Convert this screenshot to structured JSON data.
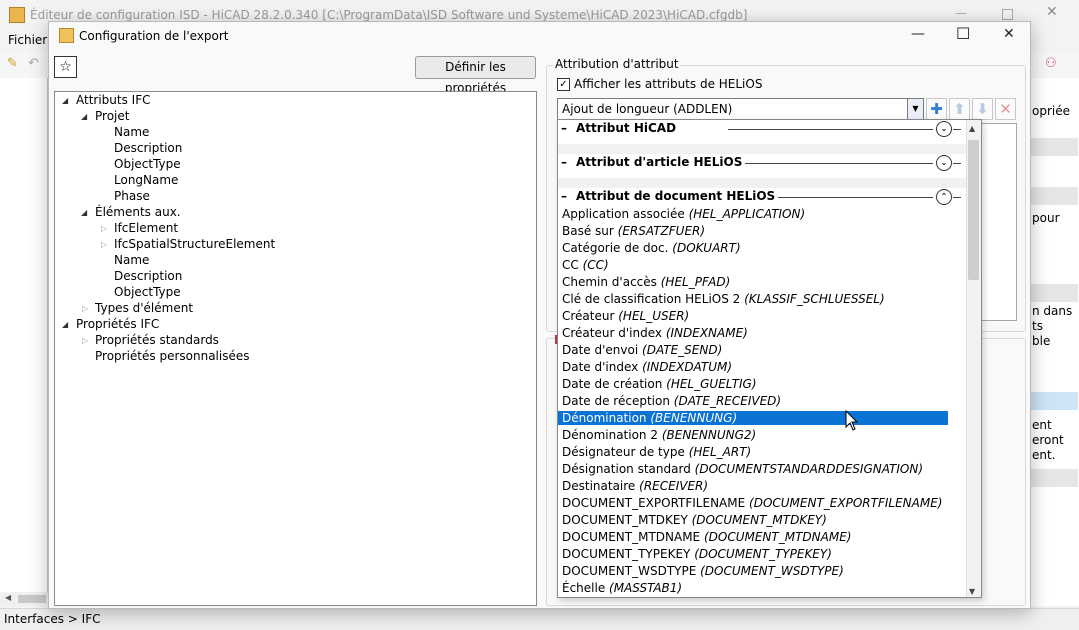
{
  "background_window": {
    "title": "Éditeur de configuration ISD - HiCAD 28.2.0.340 [C:\\ProgramData\\ISD Software und Systeme\\HiCAD 2023\\HiCAD.cfgdb]",
    "menu_file": "Fichier",
    "right_panel_texts": [
      "opriée",
      "pour",
      "n dans",
      "ts",
      "ble",
      "ent",
      "eront",
      "ent."
    ],
    "status_path": "Interfaces > IFC"
  },
  "dialog": {
    "title": "Configuration de l'export",
    "minimize_glyph": "—",
    "maximize_glyph": "☐",
    "close_glyph": "✕",
    "star_glyph": "☆",
    "define_button": "Définir les propriétés",
    "tree": [
      {
        "label": "Attributs IFC",
        "toggle": "◢"
      },
      {
        "label": "Projet",
        "toggle": "◢"
      },
      {
        "label": "Name"
      },
      {
        "label": "Description"
      },
      {
        "label": "ObjectType"
      },
      {
        "label": "LongName"
      },
      {
        "label": "Phase"
      },
      {
        "label": "Éléments aux.",
        "toggle": "◢"
      },
      {
        "label": "IfcElement",
        "toggle": "▷"
      },
      {
        "label": "IfcSpatialStructureElement",
        "toggle": "▷"
      },
      {
        "label": "Name"
      },
      {
        "label": "Description"
      },
      {
        "label": "ObjectType"
      },
      {
        "label": "Types d'élément",
        "toggle": "▷"
      },
      {
        "label": "Propriétés IFC",
        "toggle": "◢"
      },
      {
        "label": "Propriétés standards",
        "toggle": "▷"
      },
      {
        "label": "Propriétés personnalisées"
      }
    ],
    "attribution": {
      "group_label": "Attribution d'attribut",
      "checkbox_label": "Afficher les attributs de HELiOS",
      "checkbox_checked": true,
      "check_glyph": "✓",
      "combo_value": "Ajout de longueur (ADDLEN)",
      "combo_arrow": "▼",
      "add_glyph": "✚",
      "up_glyph": "⬆",
      "down_glyph": "⬇",
      "delete_glyph": "✕"
    },
    "dropdown": {
      "groups": [
        {
          "label": "Attribut HiCAD",
          "dash": "–",
          "toggle": "⌄"
        },
        {
          "label": "Attribut d'article HELiOS",
          "dash": "–",
          "toggle": "⌄"
        },
        {
          "label": "Attribut de document HELiOS",
          "dash": "–",
          "toggle": "⌃"
        }
      ],
      "items": [
        {
          "name": "Application associée",
          "code": "(HEL_APPLICATION)"
        },
        {
          "name": "Basé sur",
          "code": "(ERSATZFUER)"
        },
        {
          "name": "Catégorie de doc.",
          "code": "(DOKUART)"
        },
        {
          "name": "CC",
          "code": "(CC)"
        },
        {
          "name": "Chemin d'accès",
          "code": "(HEL_PFAD)"
        },
        {
          "name": "Clé de classification HELiOS 2",
          "code": "(KLASSIF_SCHLUESSEL)"
        },
        {
          "name": "Créateur",
          "code": "(HEL_USER)"
        },
        {
          "name": "Créateur d'index",
          "code": "(INDEXNAME)"
        },
        {
          "name": "Date d'envoi",
          "code": "(DATE_SEND)"
        },
        {
          "name": "Date d'index",
          "code": "(INDEXDATUM)"
        },
        {
          "name": "Date de création",
          "code": "(HEL_GUELTIG)"
        },
        {
          "name": "Date de réception",
          "code": "(DATE_RECEIVED)"
        },
        {
          "name": "Dénomination",
          "code": "(BENENNUNG)"
        },
        {
          "name": "Dénomination 2",
          "code": "(BENENNUNG2)"
        },
        {
          "name": "Désignateur de type",
          "code": "(HEL_ART)"
        },
        {
          "name": "Désignation standard",
          "code": "(DOCUMENTSTANDARDDESIGNATION)"
        },
        {
          "name": "Destinataire",
          "code": "(RECEIVER)"
        },
        {
          "name": "DOCUMENT_EXPORTFILENAME",
          "code": "(DOCUMENT_EXPORTFILENAME)"
        },
        {
          "name": "DOCUMENT_MTDKEY",
          "code": "(DOCUMENT_MTDKEY)"
        },
        {
          "name": "DOCUMENT_MTDNAME",
          "code": "(DOCUMENT_MTDNAME)"
        },
        {
          "name": "DOCUMENT_TYPEKEY",
          "code": "(DOCUMENT_TYPEKEY)"
        },
        {
          "name": "DOCUMENT_WSDTYPE",
          "code": "(DOCUMENT_WSDTYPE)"
        },
        {
          "name": "Échelle",
          "code": "(MASSTAB1)"
        }
      ],
      "selected_index": 12,
      "scroll_up": "▲",
      "scroll_down": "▼"
    }
  },
  "colors": {
    "selection": "#0b73d3",
    "add_icon": "#2f7fd6"
  }
}
